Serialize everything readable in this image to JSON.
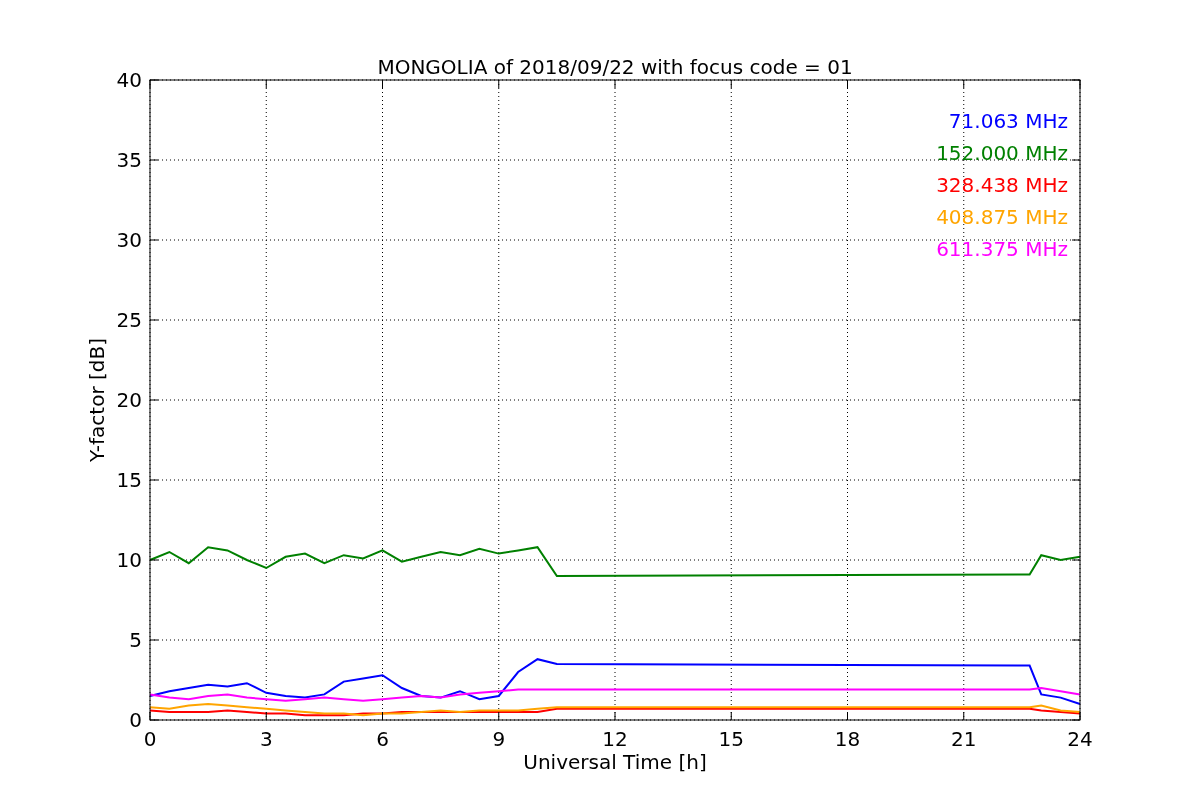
{
  "chart_data": {
    "type": "line",
    "title": "MONGOLIA of 2018/09/22 with focus code = 01",
    "xlabel": "Universal Time [h]",
    "ylabel": "Y-factor [dB]",
    "x": [
      0,
      0.5,
      1,
      1.5,
      2,
      2.5,
      3,
      3.5,
      4,
      4.5,
      5,
      5.5,
      6,
      6.5,
      7,
      7.5,
      8,
      8.5,
      9,
      9.5,
      10,
      10.5,
      22.7,
      23,
      23.5,
      24
    ],
    "series": [
      {
        "name": "71.063 MHz",
        "color": "#0000ff",
        "values": [
          1.5,
          1.8,
          2.0,
          2.2,
          2.1,
          2.3,
          1.7,
          1.5,
          1.4,
          1.6,
          2.4,
          2.6,
          2.8,
          2.0,
          1.5,
          1.4,
          1.8,
          1.3,
          1.5,
          3.0,
          3.8,
          3.5,
          3.4,
          1.6,
          1.4,
          1.0
        ]
      },
      {
        "name": "152.000 MHz",
        "color": "#008000",
        "values": [
          10.0,
          10.5,
          9.8,
          10.8,
          10.6,
          10.0,
          9.5,
          10.2,
          10.4,
          9.8,
          10.3,
          10.1,
          10.6,
          9.9,
          10.2,
          10.5,
          10.3,
          10.7,
          10.4,
          10.6,
          10.8,
          9.0,
          9.1,
          10.3,
          10.0,
          10.2
        ]
      },
      {
        "name": "328.438 MHz",
        "color": "#ff0000",
        "values": [
          0.6,
          0.5,
          0.5,
          0.5,
          0.6,
          0.5,
          0.4,
          0.4,
          0.3,
          0.3,
          0.3,
          0.4,
          0.4,
          0.5,
          0.5,
          0.5,
          0.5,
          0.5,
          0.5,
          0.5,
          0.5,
          0.7,
          0.7,
          0.6,
          0.5,
          0.4
        ]
      },
      {
        "name": "408.875 MHz",
        "color": "#ffa500",
        "values": [
          0.8,
          0.7,
          0.9,
          1.0,
          0.9,
          0.8,
          0.7,
          0.6,
          0.5,
          0.4,
          0.4,
          0.3,
          0.4,
          0.4,
          0.5,
          0.6,
          0.5,
          0.6,
          0.6,
          0.6,
          0.7,
          0.8,
          0.8,
          0.9,
          0.6,
          0.5
        ]
      },
      {
        "name": "611.375 MHz",
        "color": "#ff00ff",
        "values": [
          1.6,
          1.4,
          1.3,
          1.5,
          1.6,
          1.4,
          1.3,
          1.2,
          1.3,
          1.4,
          1.3,
          1.2,
          1.3,
          1.4,
          1.5,
          1.4,
          1.6,
          1.7,
          1.8,
          1.9,
          1.9,
          1.9,
          1.9,
          2.0,
          1.8,
          1.6
        ]
      }
    ],
    "grid": true,
    "xlim": [
      0,
      24
    ],
    "ylim": [
      0,
      40
    ],
    "xticks": [
      0,
      3,
      6,
      9,
      12,
      15,
      18,
      21,
      24
    ],
    "yticks": [
      0,
      5,
      10,
      15,
      20,
      25,
      30,
      35,
      40
    ]
  }
}
